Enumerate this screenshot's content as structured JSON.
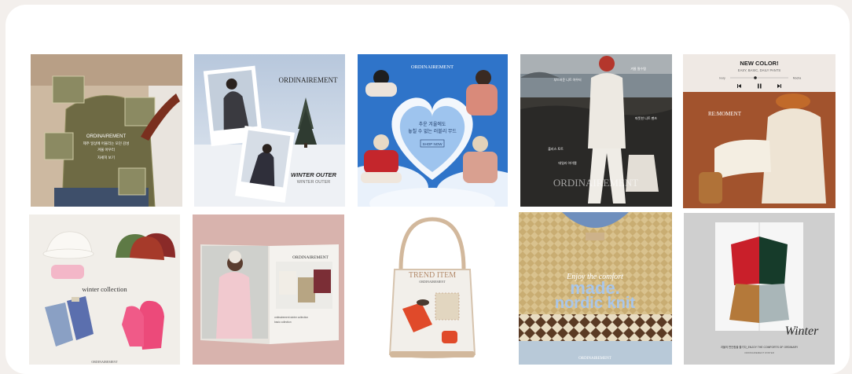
{
  "gallery": {
    "t1": {
      "brand": "ORDINAIREMENT",
      "line1": "제주 일상에 어울리는 모던 감성",
      "line2": "겨울 아우터",
      "button": "자세히 보기"
    },
    "t2": {
      "brand": "ORDINAIREMENT",
      "title": "WINTER OUTER",
      "subtitle": "WINTER OUTER"
    },
    "t3": {
      "brand": "ORDINAIREMENT",
      "line1": "추운 겨울에도",
      "line2": "놓칠 수 없는 러블리 무드",
      "button": "SHOP NOW"
    },
    "t4": {
      "label1": "부드러운 니트 아우터",
      "label2": "겨울 필수템",
      "label3": "따뜻한 니트 팬츠",
      "label4": "플리스 토트",
      "label5": "데일리 아이템",
      "brand": "ORDINAIREMENT"
    },
    "t5": {
      "title": "NEW COLOR!",
      "subtitle": "EASY, BASIC, DAILY PANTS",
      "player_left": "Ivory",
      "player_right": "Mocha",
      "brand": "RE:MOMENT"
    },
    "t6": {
      "title": "winter collection",
      "brand": "ORDINAIREMENT"
    },
    "t7": {
      "brand": "ORDINAIREMENT",
      "caption1": "ordinairement winter collection",
      "caption2": "basic collection"
    },
    "t8": {
      "title": "TREND ITEM",
      "brand": "ORDINAIREMENT"
    },
    "t9": {
      "script": "Enjoy the comfort",
      "line1": "made.",
      "line2": "nordic knit",
      "brand": "ORDINAIREMENT"
    },
    "t10": {
      "script": "Winter",
      "caption": "겨울의 편안함을 즐기다_ENJOY THE COMFORTS OF ORDINARY",
      "sub": "ORDINAIREMENT WINTER"
    }
  },
  "colors": {
    "page_bg": "#f3efec",
    "card_bg": "#ffffff"
  }
}
